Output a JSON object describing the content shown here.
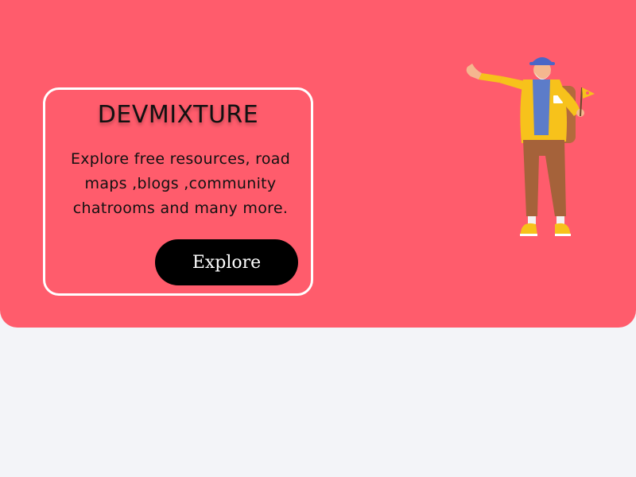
{
  "hero": {
    "background_color": "#ff5c6c",
    "brand_title": "DEVMIXTURE",
    "description": "Explore free resources, road maps ,blogs ,community chatrooms and many more.",
    "cta_label": "Explore",
    "illustration_icon": "tour-guide-illustration"
  },
  "colors": {
    "page_background": "#f3f4f8",
    "button_background": "#000000",
    "button_text": "#ffffff",
    "card_border": "#ffffff"
  }
}
